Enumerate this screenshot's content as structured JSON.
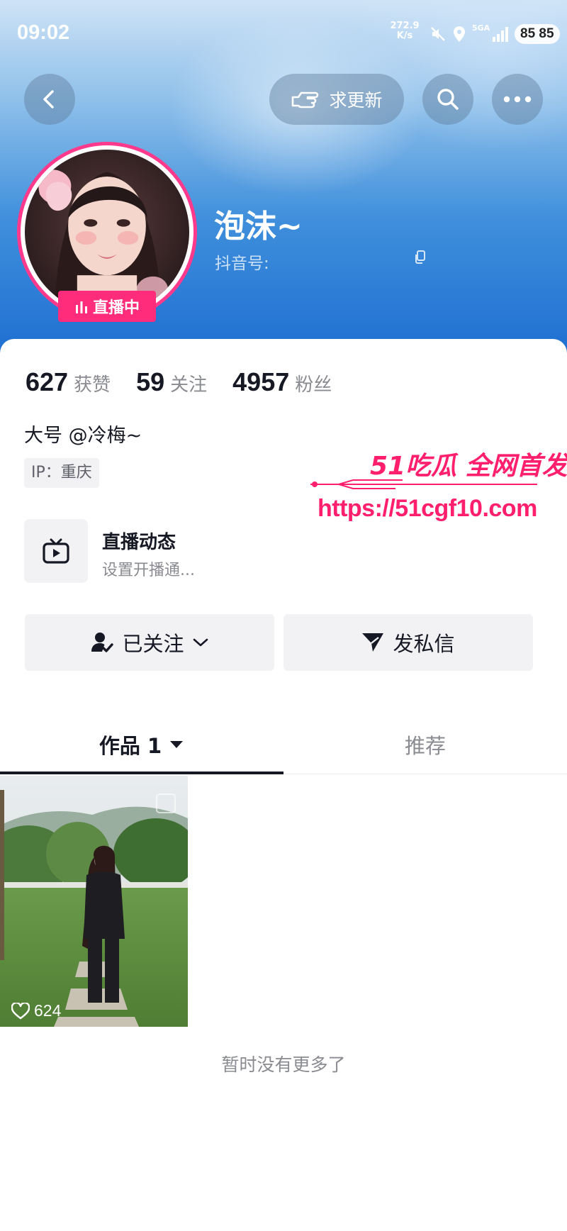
{
  "status_bar": {
    "time": "09:02",
    "net_speed_value": "272.9",
    "net_speed_unit": "K/s",
    "signal_label": "5GA",
    "battery": "85 85"
  },
  "header": {
    "request_update_label": "求更新",
    "nickname": "泡沫~",
    "douyin_id_label": "抖音号:",
    "live_badge": "直播中",
    "colors": {
      "live_pink": "#fe2c7a",
      "header_blue": "#1f6fd2"
    }
  },
  "stats": [
    {
      "value": "627",
      "label": "获赞"
    },
    {
      "value": "59",
      "label": "关注"
    },
    {
      "value": "4957",
      "label": "粉丝"
    }
  ],
  "bio": "大号 @冷梅~",
  "ip_tag": "IP：重庆",
  "watermark": {
    "line1": "51吃瓜 全网首发",
    "line2": "https://51cgf10.com"
  },
  "live_feed": {
    "title": "直播动态",
    "subtitle": "设置开播通..."
  },
  "actions": {
    "follow_label": "已关注",
    "message_label": "发私信"
  },
  "tabs": [
    {
      "label": "作品 1"
    },
    {
      "label": "推荐"
    }
  ],
  "video": {
    "likes": "624"
  },
  "footer_text": "暂时没有更多了",
  "icons": [
    "back-icon",
    "pointing-hand-icon",
    "search-icon",
    "more-icon",
    "live-bars-icon",
    "copy-icon",
    "tv-icon",
    "person-check-icon",
    "chevron-down-icon",
    "send-icon",
    "caret-down-icon",
    "heart-icon",
    "mute-icon",
    "location-icon",
    "signal-icon"
  ]
}
